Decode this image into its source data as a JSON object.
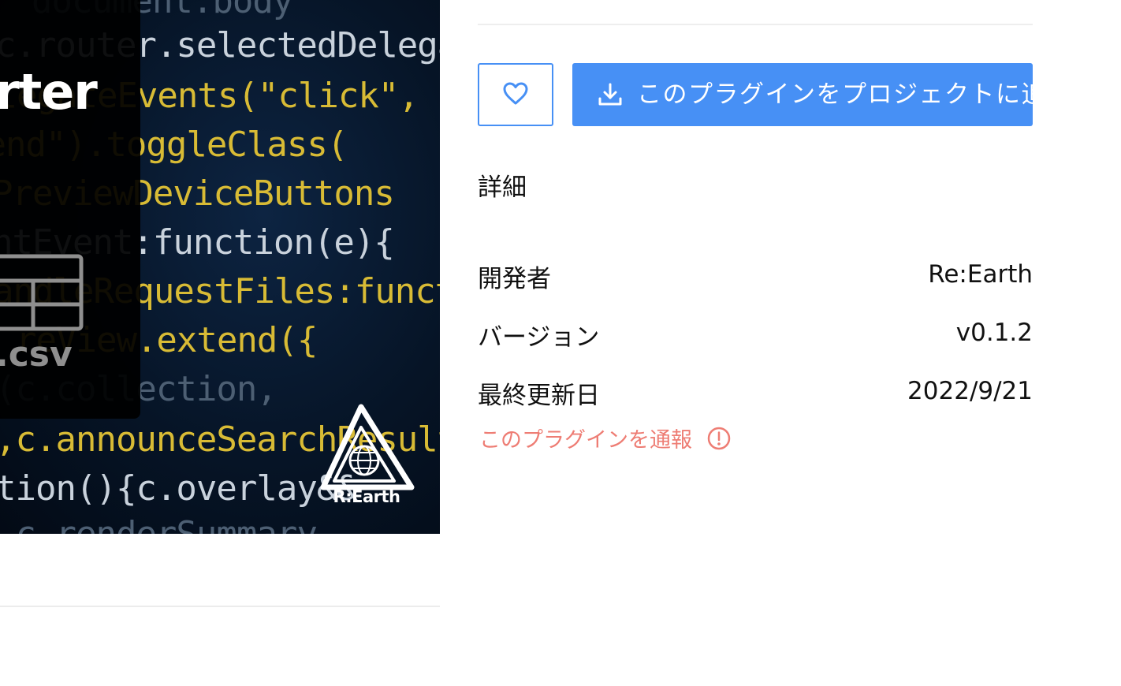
{
  "hero": {
    "card_title": "rter",
    "card_extension": ".csv",
    "logo_text": "R:Earth",
    "code_lines": [
      "document.body",
      "c.router.selectedDelegates",
      "elegateEvents(\"click\",",
      "\"end\").toggleClass(",
      "PreviewDeviceButtons",
      "ntEvent:function(e){",
      "(handleRequestFiles:function",
      "reView.extend({",
      "(c.collection,",
      ",c.announceSearchResult",
      "tion(){c.overlay&&",
      ",c.renderSummary"
    ]
  },
  "actions": {
    "favorite_icon": "heart-icon",
    "add_icon": "download-icon",
    "add_label": "このプラグインをプロジェクトに追加"
  },
  "details": {
    "title": "詳細",
    "developer_label": "開発者",
    "developer_value": "Re:Earth",
    "version_label": "バージョン",
    "version_value": "v0.1.2",
    "updated_label": "最終更新日",
    "updated_value": "2022/9/21"
  },
  "report": {
    "label": "このプラグインを通報",
    "icon": "alert-circle-icon"
  },
  "colors": {
    "primary": "#4790f5",
    "danger": "#ee7d74",
    "text": "#111111"
  }
}
